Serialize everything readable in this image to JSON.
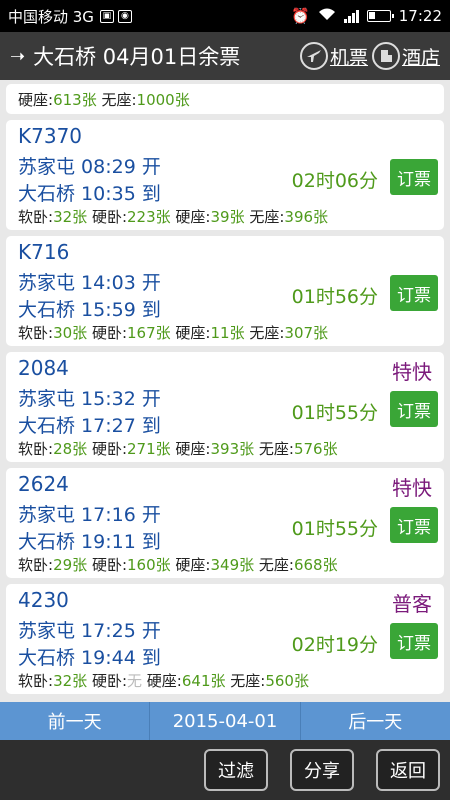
{
  "status_bar": {
    "carrier": "中国移动 3G",
    "time": "17:22"
  },
  "header": {
    "back_icon": "arrow-right-icon",
    "title": "大石桥 04月01日余票",
    "flight_label": "机票",
    "hotel_label": "酒店"
  },
  "partial_row": [
    {
      "label": "硬座:",
      "count": "613张"
    },
    {
      "label": "无座:",
      "count": "1000张"
    }
  ],
  "trains": [
    {
      "number": "K7370",
      "type": "",
      "depart": "苏家屯 08:29 开",
      "arrive": "大石桥 10:35 到",
      "duration": "02时06分",
      "book_label": "订票",
      "seats": [
        {
          "label": "软卧:",
          "count": "32张"
        },
        {
          "label": "硬卧:",
          "count": "223张"
        },
        {
          "label": "硬座:",
          "count": "39张"
        },
        {
          "label": "无座:",
          "count": "396张"
        }
      ]
    },
    {
      "number": "K716",
      "type": "",
      "depart": "苏家屯 14:03 开",
      "arrive": "大石桥 15:59 到",
      "duration": "01时56分",
      "book_label": "订票",
      "seats": [
        {
          "label": "软卧:",
          "count": "30张"
        },
        {
          "label": "硬卧:",
          "count": "167张"
        },
        {
          "label": "硬座:",
          "count": "11张"
        },
        {
          "label": "无座:",
          "count": "307张"
        }
      ]
    },
    {
      "number": "2084",
      "type": "特快",
      "depart": "苏家屯 15:32 开",
      "arrive": "大石桥 17:27 到",
      "duration": "01时55分",
      "book_label": "订票",
      "seats": [
        {
          "label": "软卧:",
          "count": "28张"
        },
        {
          "label": "硬卧:",
          "count": "271张"
        },
        {
          "label": "硬座:",
          "count": "393张"
        },
        {
          "label": "无座:",
          "count": "576张"
        }
      ]
    },
    {
      "number": "2624",
      "type": "特快",
      "depart": "苏家屯 17:16 开",
      "arrive": "大石桥 19:11 到",
      "duration": "01时55分",
      "book_label": "订票",
      "seats": [
        {
          "label": "软卧:",
          "count": "29张"
        },
        {
          "label": "硬卧:",
          "count": "160张"
        },
        {
          "label": "硬座:",
          "count": "349张"
        },
        {
          "label": "无座:",
          "count": "668张"
        }
      ]
    },
    {
      "number": "4230",
      "type": "普客",
      "depart": "苏家屯 17:25 开",
      "arrive": "大石桥 19:44 到",
      "duration": "02时19分",
      "book_label": "订票",
      "seats": [
        {
          "label": "软卧:",
          "count": "32张"
        },
        {
          "label": "硬卧:",
          "count": "无"
        },
        {
          "label": "硬座:",
          "count": "641张"
        },
        {
          "label": "无座:",
          "count": "560张"
        }
      ]
    }
  ],
  "date_bar": {
    "prev": "前一天",
    "date": "2015-04-01",
    "next": "后一天"
  },
  "toolbar": {
    "filter": "过滤",
    "share": "分享",
    "back": "返回"
  },
  "colors": {
    "accent_blue": "#1a4fa0",
    "count_green": "#4f9a1b",
    "book_green": "#3aa637",
    "type_purple": "#7b1a7b",
    "date_bar": "#5c95d2"
  }
}
